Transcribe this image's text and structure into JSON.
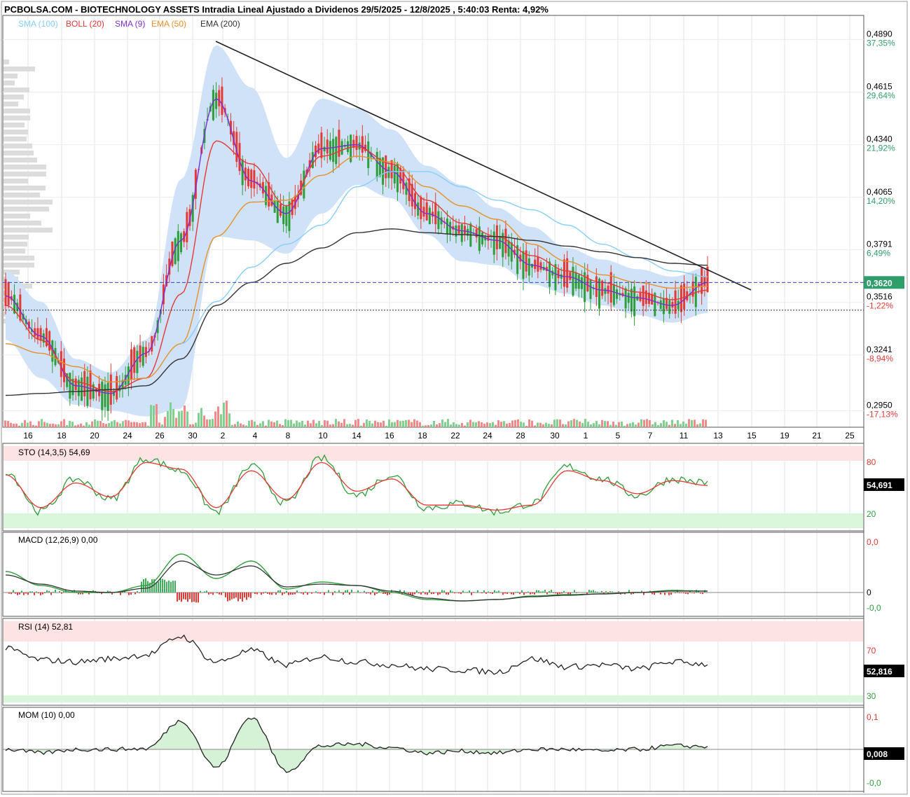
{
  "title": "PCBOLSA.COM - BIOTECHNOLOGY ASSETS Intradia Lineal Ajustado a Dividenos 29/5/2025 - 12/8/2025 , 5:40:03 Renta: 4,92%",
  "legend": [
    {
      "label": "SMA",
      "param": "(100)",
      "color": "#87cefa"
    },
    {
      "label": "BOLL",
      "param": "(20)",
      "color": "#e53935"
    },
    {
      "label": "SMA",
      "param": "(9)",
      "color": "#7b2fd6"
    },
    {
      "label": "EMA",
      "param": "(50)",
      "color": "#e8902a"
    },
    {
      "label": "EMA",
      "param": "(200)",
      "color": "#333333"
    }
  ],
  "price_axis": {
    "levels": [
      {
        "value": "0,4890",
        "pct": "37,35%",
        "pct_color": "#2e9e6b"
      },
      {
        "value": "0,4615",
        "pct": "29,64%",
        "pct_color": "#2e9e6b"
      },
      {
        "value": "0,4340",
        "pct": "21,92%",
        "pct_color": "#2e9e6b"
      },
      {
        "value": "0,4065",
        "pct": "14,20%",
        "pct_color": "#2e9e6b"
      },
      {
        "value": "0,3791",
        "pct": "6,49%",
        "pct_color": "#2e9e6b"
      },
      {
        "value": "0,3516",
        "pct": "-1,22%",
        "pct_color": "#e53935"
      },
      {
        "value": "0,3241",
        "pct": "-8,94%",
        "pct_color": "#e53935"
      },
      {
        "value": "0,2950",
        "pct": "-17,13%",
        "pct_color": "#e53935"
      }
    ],
    "current": "0,3620",
    "current_color": "#2e9e6b"
  },
  "x_axis_labels": [
    "16",
    "18",
    "20",
    "24",
    "26",
    "30",
    "2",
    "4",
    "8",
    "10",
    "14",
    "16",
    "18",
    "22",
    "24",
    "28",
    "30",
    "1",
    "5",
    "7",
    "11",
    "13",
    "15",
    "19",
    "21",
    "25"
  ],
  "panels": {
    "sto": {
      "label": "STO (14,3,5)",
      "value": "54,69",
      "levels": [
        "80",
        "20"
      ],
      "badge": "54,691"
    },
    "macd": {
      "label": "MACD (12,26,9)",
      "value": "0,00",
      "levels": [
        "0,0",
        "0",
        "-0,0"
      ]
    },
    "rsi": {
      "label": "RSI (14)",
      "value": "52,81",
      "levels": [
        "70",
        "30"
      ],
      "badge": "52,816"
    },
    "mom": {
      "label": "MOM (10)",
      "value": "0,00",
      "levels": [
        "0,1",
        "-0,0"
      ],
      "badge": "0,008"
    }
  },
  "chart_data": {
    "type": "line",
    "title": "PCBOLSA.COM - BIOTECHNOLOGY ASSETS Intradia Lineal Ajustado a Dividenos 29/5/2025 - 12/8/2025 , 5:40:03 Renta: 4,92%",
    "x": [
      "16",
      "18",
      "20",
      "24",
      "26",
      "30",
      "2",
      "4",
      "8",
      "10",
      "14",
      "16",
      "18",
      "22",
      "24",
      "28",
      "30",
      "1",
      "5",
      "7",
      "11"
    ],
    "ylim": [
      0.29,
      0.495
    ],
    "series": [
      {
        "name": "SMA (9)",
        "values": [
          0.355,
          0.334,
          0.308,
          0.304,
          0.325,
          0.384,
          0.458,
          0.415,
          0.398,
          0.432,
          0.434,
          0.42,
          0.398,
          0.389,
          0.384,
          0.371,
          0.365,
          0.358,
          0.354,
          0.35,
          0.362
        ]
      },
      {
        "name": "BOLL (20)",
        "values": [
          0.35,
          0.332,
          0.31,
          0.305,
          0.312,
          0.356,
          0.436,
          0.424,
          0.402,
          0.428,
          0.433,
          0.424,
          0.405,
          0.393,
          0.386,
          0.376,
          0.368,
          0.362,
          0.357,
          0.353,
          0.358
        ]
      },
      {
        "name": "EMA (50)",
        "values": [
          0.33,
          0.325,
          0.318,
          0.31,
          0.312,
          0.33,
          0.386,
          0.404,
          0.405,
          0.418,
          0.428,
          0.425,
          0.412,
          0.402,
          0.395,
          0.382,
          0.373,
          0.366,
          0.362,
          0.359,
          0.36
        ]
      },
      {
        "name": "SMA (100)",
        "values": [
          null,
          null,
          null,
          null,
          null,
          0.33,
          0.352,
          0.37,
          0.382,
          0.392,
          0.412,
          0.42,
          0.42,
          0.412,
          0.405,
          0.4,
          0.392,
          0.382,
          0.375,
          0.368,
          0.365
        ]
      },
      {
        "name": "EMA (200)",
        "values": [
          0.303,
          0.304,
          0.305,
          0.306,
          0.308,
          0.322,
          0.35,
          0.362,
          0.372,
          0.38,
          0.388,
          0.39,
          0.388,
          0.387,
          0.386,
          0.384,
          0.381,
          0.378,
          0.375,
          0.372,
          0.371
        ]
      }
    ],
    "price_close_last": 0.362,
    "reference_price": 0.356,
    "trendline": {
      "from": {
        "x": "31",
        "y": 0.488
      },
      "to": {
        "x": "14",
        "y": 0.356
      }
    },
    "stochastic": {
      "k": [
        70,
        20,
        60,
        35,
        85,
        70,
        20,
        75,
        30,
        85,
        40,
        65,
        25,
        30,
        20,
        30,
        75,
        60,
        40,
        60,
        55
      ],
      "d": [
        65,
        25,
        55,
        38,
        80,
        72,
        25,
        70,
        35,
        80,
        45,
        60,
        28,
        28,
        22,
        28,
        70,
        58,
        42,
        58,
        52
      ]
    },
    "rsi": [
      68,
      57,
      55,
      58,
      62,
      80,
      55,
      66,
      52,
      60,
      55,
      52,
      48,
      47,
      45,
      58,
      50,
      52,
      48,
      55,
      52.8
    ],
    "momentum": [
      0.0,
      -0.01,
      0.0,
      0.0,
      0.002,
      0.08,
      -0.05,
      0.09,
      -0.06,
      0.01,
      0.015,
      0.005,
      -0.01,
      -0.005,
      -0.01,
      0.0,
      0.0,
      -0.005,
      0.0,
      0.01,
      0.008
    ],
    "grid": true,
    "legend_position": "top-left"
  }
}
